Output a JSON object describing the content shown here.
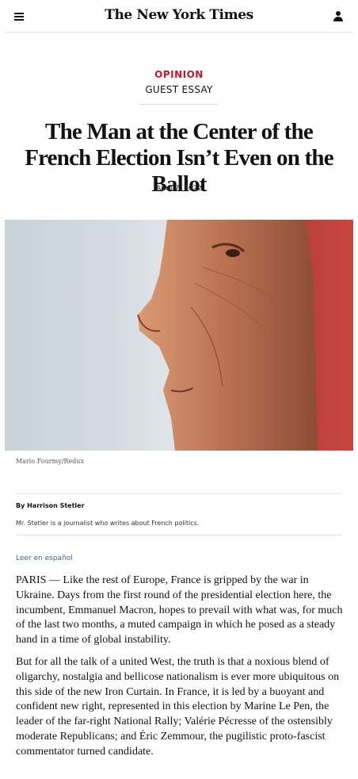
{
  "header": {
    "logo": "The New York Times",
    "menu_icon": "hamburger-menu-icon",
    "account_icon": "account-person-icon"
  },
  "article": {
    "kicker": "OPINION",
    "subkicker": "GUEST ESSAY",
    "headline": "The Man at the Center of the French Election Isn’t Even on the Ballot",
    "date": "April 7, 2022",
    "photo_credit": "Mario Fourmy/Redux",
    "byline": "By Harrison Stetler",
    "author_bio": "Mr. Stetler is a journalist who writes about French politics.",
    "language_link": "Leer en español",
    "paragraphs": [
      "PARIS — Like the rest of Europe, France is gripped by the war in Ukraine. Days from the first round of the presidential election here, the incumbent, Emmanuel Macron, hopes to prevail with what was, for much of the last two months, a muted campaign in which he posed as a steady hand in a time of global instability.",
      "But for all the talk of a united West, the truth is that a noxious blend of oligarchy, nostalgia and bellicose nationalism is ever more ubiquitous on this side of the new Iron Curtain. In France, it is led by a buoyant and confident new right, represented in this election by Marine Le Pen, the leader of the far-right National Rally; Valérie Pécresse of the ostensibly moderate Republicans; and Éric Zemmour, the pugilistic proto-fascist commentator turned candidate."
    ]
  },
  "colors": {
    "kicker": "#c7162b",
    "link": "#326891",
    "text": "#121212"
  }
}
